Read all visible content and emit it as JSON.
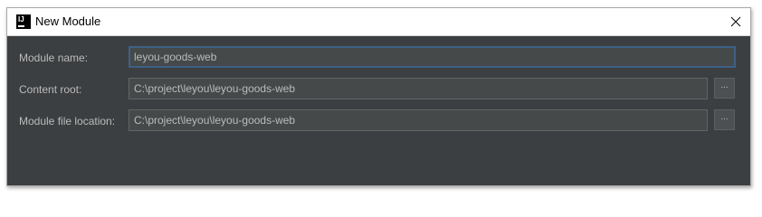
{
  "window": {
    "title": "New Module",
    "app_icon_text": "IJ"
  },
  "form": {
    "module_name": {
      "label": "Module name:",
      "value": "leyou-goods-web"
    },
    "content_root": {
      "label": "Content root:",
      "value": "C:\\project\\leyou\\leyou-goods-web",
      "browse_label": "..."
    },
    "module_file_location": {
      "label": "Module file location:",
      "value": "C:\\project\\leyou\\leyou-goods-web",
      "browse_label": "..."
    }
  },
  "colors": {
    "dialog_background": "#3c3f41",
    "field_background": "#45494a",
    "focus_border": "#3d6185",
    "label_text": "#bbbbbb"
  }
}
